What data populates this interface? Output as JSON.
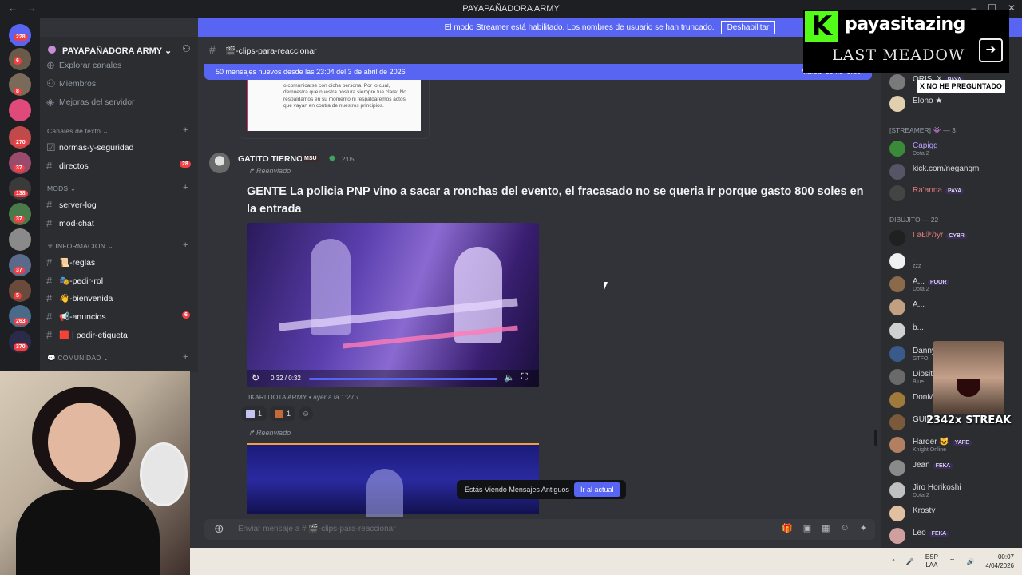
{
  "window": {
    "title": "PAYAPAÑADORA ARMY"
  },
  "banner": {
    "text": "El modo Streamer está habilitado. Los nombres de usuario se han truncado.",
    "button": "Deshabilitar"
  },
  "guilds": {
    "badges": [
      "228",
      "6",
      "8",
      "270",
      "37",
      "138",
      "37",
      "37",
      "5",
      "263",
      "370"
    ]
  },
  "server": {
    "name": "PAYAPAÑADORA ARMY"
  },
  "sidebar": {
    "top_items": [
      {
        "label": "Explorar canales"
      },
      {
        "label": "Miembros"
      },
      {
        "label": "Mejoras del servidor"
      }
    ],
    "categories": {
      "text": "Canales de texto",
      "mods": "MODS",
      "info": "INFORMACION",
      "community": "COMUNIDAD"
    },
    "channels": [
      {
        "label": "normas-y-seguridad"
      },
      {
        "label": "directos",
        "badge": "28"
      },
      {
        "label": "server-log"
      },
      {
        "label": "mod-chat"
      },
      {
        "label": "📜-reglas"
      },
      {
        "label": "🎭-pedir-rol"
      },
      {
        "label": "👋-bienvenida"
      },
      {
        "label": "📢-anuncios",
        "badge": "6"
      },
      {
        "label": "🟥 | pedir-etiqueta"
      }
    ]
  },
  "channel": {
    "name": "🎬-clips-para-reaccionar"
  },
  "new_messages": {
    "text": "50 mensajes nuevos desde las 23:04 del 3 de abril de 2026",
    "action": "Marcar como leído"
  },
  "prev_attachment": {
    "text": "o comunicarse con dicha persona. Por lo cual, demuestra que nuestra postura siempre fue clara: No respaldamos en su momento ni respaldaremos actos que vayan en contra de nuestros principios."
  },
  "message": {
    "author": "GATITO TIERNO",
    "role_tag": "MSU",
    "time": "2:05",
    "forwarded": "Reenviado",
    "text": "GENTE La policia PNP vino a sacar a ronchas del evento, el fracasado no se queria ir porque gasto 800 soles en la entrada",
    "video_time": "0:32 / 0:32",
    "source": "IKARI DOTA ARMY • ayer a la 1:27",
    "reactions": [
      {
        "count": "1",
        "color": "#c4c4f0"
      },
      {
        "count": "1",
        "color": "#c46a3a"
      }
    ],
    "forwarded2": "Reenviado"
  },
  "old_messages": {
    "text": "Estás Viendo Mensajes Antiguos",
    "button": "Ir al actual"
  },
  "composer": {
    "placeholder": "Enviar mensaje a # 🎬-clips-para-reaccionar"
  },
  "members": {
    "top": [
      {
        "name": "ORIS_X",
        "tag": "PAYA",
        "color": "#7a7a7a"
      },
      {
        "name": "Elono ★",
        "tag": "",
        "color": "#e0d0b0"
      }
    ],
    "streamer_header": "[STREAMER] 👾 — 3",
    "streamers": [
      {
        "name": "Capigg",
        "sub": "Dota 2",
        "color": "#3a8a3a"
      },
      {
        "name": "kick.com/negangm",
        "sub": "",
        "color": "#555566"
      },
      {
        "name": "Ra'anna",
        "tag": "PAYA",
        "sub": "",
        "color": "#444"
      }
    ],
    "dibujito_header": "DIBUJITO — 22",
    "dibujitos": [
      {
        "name": "! aŁℙℎyr",
        "tag": "CYBR",
        "sub": "",
        "color": "#202020"
      },
      {
        "name": ".",
        "sub": "zzz",
        "color": "#f0f0f0"
      },
      {
        "name": "A...",
        "tag": "POOR",
        "sub": "Dota 2",
        "color": "#8a6a4a"
      },
      {
        "name": "A...",
        "tag": "",
        "sub": "",
        "color": "#c0a080"
      },
      {
        "name": "b...",
        "tag": "",
        "sub": "",
        "color": "#d0d0d0"
      },
      {
        "name": "Danny",
        "tag": "",
        "sub": "GTFO",
        "color": "#3a5a8a"
      },
      {
        "name": "Diosit",
        "tag": "",
        "sub": "Blue",
        "color": "#6a6a6a"
      },
      {
        "name": "DonM",
        "tag": "",
        "sub": "",
        "color": "#a07a3a"
      },
      {
        "name": "GUIL",
        "tag": "",
        "sub": "",
        "color": "#7a5a3a"
      },
      {
        "name": "Harder 😺",
        "tag": "YAPE",
        "sub": "Knight Online",
        "color": "#b08060"
      },
      {
        "name": "Jean",
        "tag": "FEKA",
        "sub": "",
        "color": "#8a8a8a"
      },
      {
        "name": "Jiro Horikoshi",
        "tag": "",
        "sub": "Dota 2",
        "color": "#c0c0c0"
      },
      {
        "name": "Krosty",
        "tag": "",
        "sub": "",
        "color": "#e0c0a0"
      },
      {
        "name": "Leo",
        "tag": "FEKA",
        "sub": "",
        "color": "#d0a0a0"
      }
    ]
  },
  "overlay": {
    "user": "payasitazing",
    "game": "LAST MEADOW",
    "no_ask": "X NO HE PREGUNTADO",
    "streak": "2342x STREAK"
  },
  "taskbar": {
    "lang1": "ESP",
    "lang2": "LAA",
    "time": "00:07",
    "date": "4/04/2026"
  }
}
